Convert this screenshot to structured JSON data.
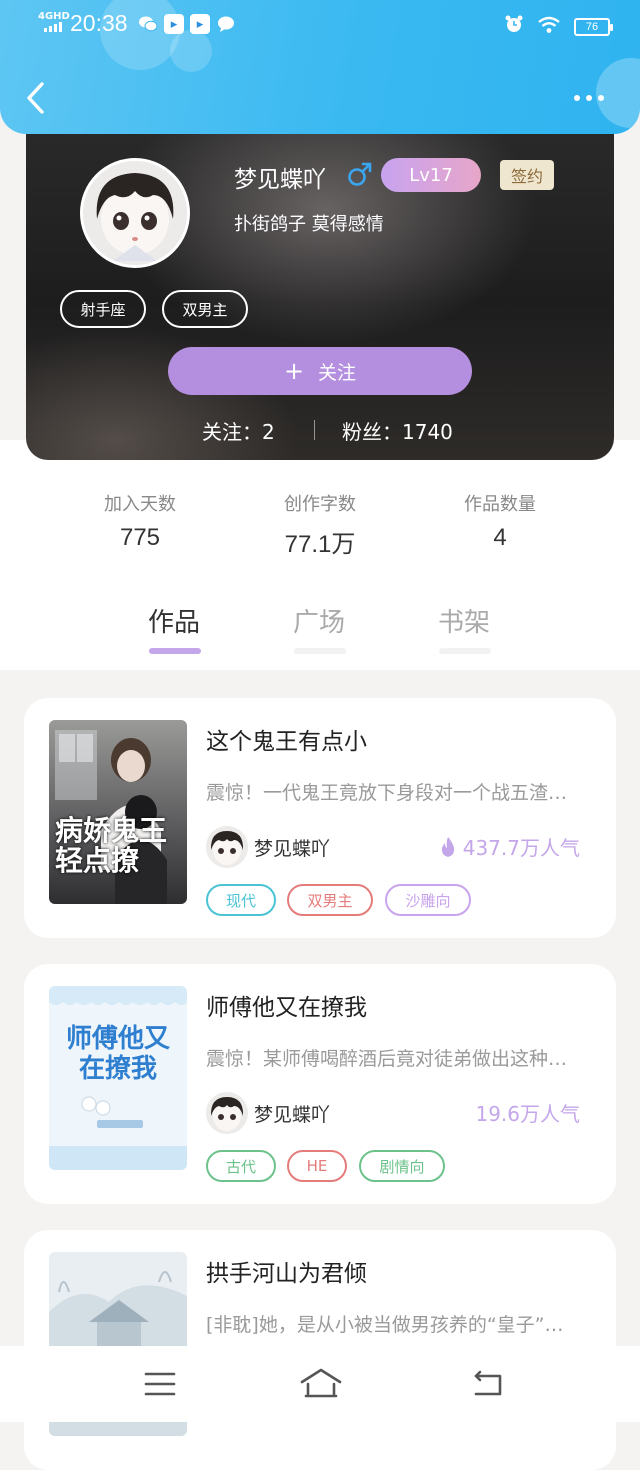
{
  "status_bar": {
    "network": "4GHD",
    "time": "20:38",
    "battery": "76"
  },
  "profile": {
    "name": "梦见蝶吖",
    "level": "Lv17",
    "contract_badge": "签约",
    "motto": "扑街鸽子 莫得感情",
    "tags": [
      "射手座",
      "双男主"
    ],
    "follow_plus": "+",
    "follow_label": "关注",
    "following": "关注：2",
    "fans": "粉丝：1740"
  },
  "counters": [
    {
      "label": "加入天数",
      "value": "775"
    },
    {
      "label": "创作字数",
      "value": "77.1万"
    },
    {
      "label": "作品数量",
      "value": "4"
    }
  ],
  "tabs": [
    "作品",
    "广场",
    "书架"
  ],
  "books": [
    {
      "title": "这个鬼王有点小",
      "desc": "震惊！一代鬼王竟放下身段对一个战五渣…",
      "author": "梦见蝶吖",
      "popularity": "437.7万人气",
      "cover_text": "病娇鬼王轻点撩",
      "tags": [
        {
          "label": "现代",
          "color": "#4bc3d4"
        },
        {
          "label": "双男主",
          "color": "#e57c7c"
        },
        {
          "label": "沙雕向",
          "color": "#c9a3ec"
        }
      ]
    },
    {
      "title": "师傅他又在撩我",
      "desc": "震惊！某师傅喝醉酒后竟对徒弟做出这种…",
      "author": "梦见蝶吖",
      "popularity": "19.6万人气",
      "cover_text": "师傅他又在撩我",
      "tags": [
        {
          "label": "古代",
          "color": "#6cc28a"
        },
        {
          "label": "HE",
          "color": "#e57c7c"
        },
        {
          "label": "剧情向",
          "color": "#6cc28a"
        }
      ]
    },
    {
      "title": "拱手河山为君倾",
      "desc": "[非耽]她，是从小被当做男孩养的“皇子”…",
      "author": "",
      "popularity": "",
      "cover_text": "",
      "tags": []
    }
  ],
  "colors": {
    "header": "#3ab9f1",
    "accent_purple": "#b48fe0",
    "tab_indicator": "#c4a6ea"
  },
  "icons": [
    "back-arrow-icon",
    "more-dots-icon",
    "male-icon",
    "flame-icon",
    "menu-icon",
    "home-icon",
    "back-nav-icon"
  ]
}
